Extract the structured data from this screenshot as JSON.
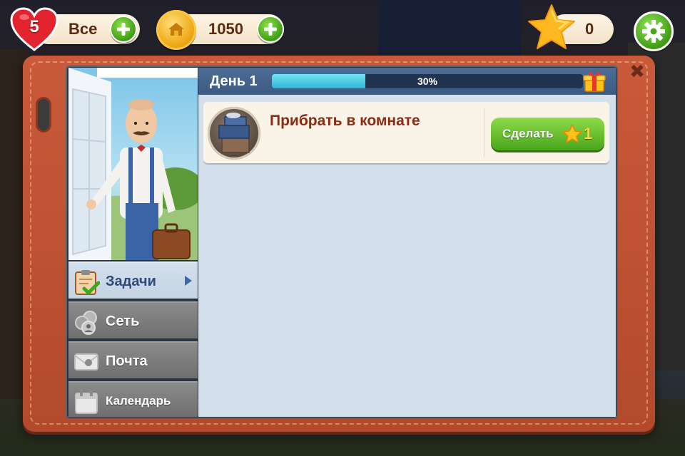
{
  "hud": {
    "lives": "5",
    "lives_label": "Все",
    "coins": "1050",
    "stars": "0"
  },
  "panel": {
    "day_label": "День 1",
    "progress_text": "30%",
    "progress_value": 0.3
  },
  "nav": {
    "items": [
      {
        "label": "Задачи",
        "icon": "clipboard-check-icon",
        "active": true
      },
      {
        "label": "Сеть",
        "icon": "friends-icon",
        "active": false
      },
      {
        "label": "Почта",
        "icon": "mail-icon",
        "active": false
      },
      {
        "label": "Календарь",
        "icon": "calendar-icon",
        "active": false
      }
    ]
  },
  "tasks": [
    {
      "title": "Прибрать в комнате",
      "action_label": "Сделать",
      "cost": "1",
      "icon": "box-pile-icon"
    }
  ],
  "colors": {
    "frame": "#c0532f",
    "button_green": "#4aa51c",
    "title_text": "#8c2a12",
    "progress_fill": "#2fb4d8"
  }
}
